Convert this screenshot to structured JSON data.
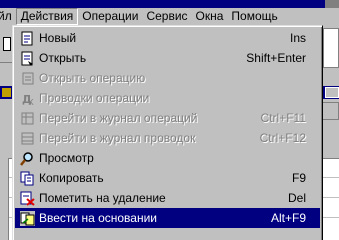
{
  "menubar": {
    "items": [
      "йл",
      "Действия",
      "Операции",
      "Сервис",
      "Окна",
      "Помощь"
    ],
    "active_index": 1
  },
  "dropdown": {
    "items": [
      {
        "label": "Новый",
        "shortcut": "Ins",
        "icon": "new-document-icon",
        "disabled": false,
        "selected": false
      },
      {
        "label": "Открыть",
        "shortcut": "Shift+Enter",
        "icon": "open-document-icon",
        "disabled": false,
        "selected": false
      },
      {
        "label": "Открыть операцию",
        "shortcut": "",
        "icon": "open-operation-icon",
        "disabled": true,
        "selected": false
      },
      {
        "label": "Проводки операции",
        "shortcut": "",
        "icon": "operation-entries-icon",
        "disabled": true,
        "selected": false
      },
      {
        "label": "Перейти в журнал операций",
        "shortcut": "Ctrl+F11",
        "icon": "operations-journal-icon",
        "disabled": true,
        "selected": false
      },
      {
        "label": "Перейти в журнал проводок",
        "shortcut": "Ctrl+F12",
        "icon": "entries-journal-icon",
        "disabled": true,
        "selected": false
      },
      {
        "label": "Просмотр",
        "shortcut": "",
        "icon": "magnifier-icon",
        "disabled": false,
        "selected": false
      },
      {
        "label": "Копировать",
        "shortcut": "F9",
        "icon": "copy-icon",
        "disabled": false,
        "selected": false
      },
      {
        "label": "Пометить на удаление",
        "shortcut": "Del",
        "icon": "mark-delete-icon",
        "disabled": false,
        "selected": false
      },
      {
        "label": "Ввести на основании",
        "shortcut": "Alt+F9",
        "icon": "enter-based-on-icon",
        "disabled": false,
        "selected": true
      }
    ]
  },
  "colors": {
    "highlight": "#000080",
    "face": "#c0c0c0",
    "disabled_text": "#808080"
  }
}
